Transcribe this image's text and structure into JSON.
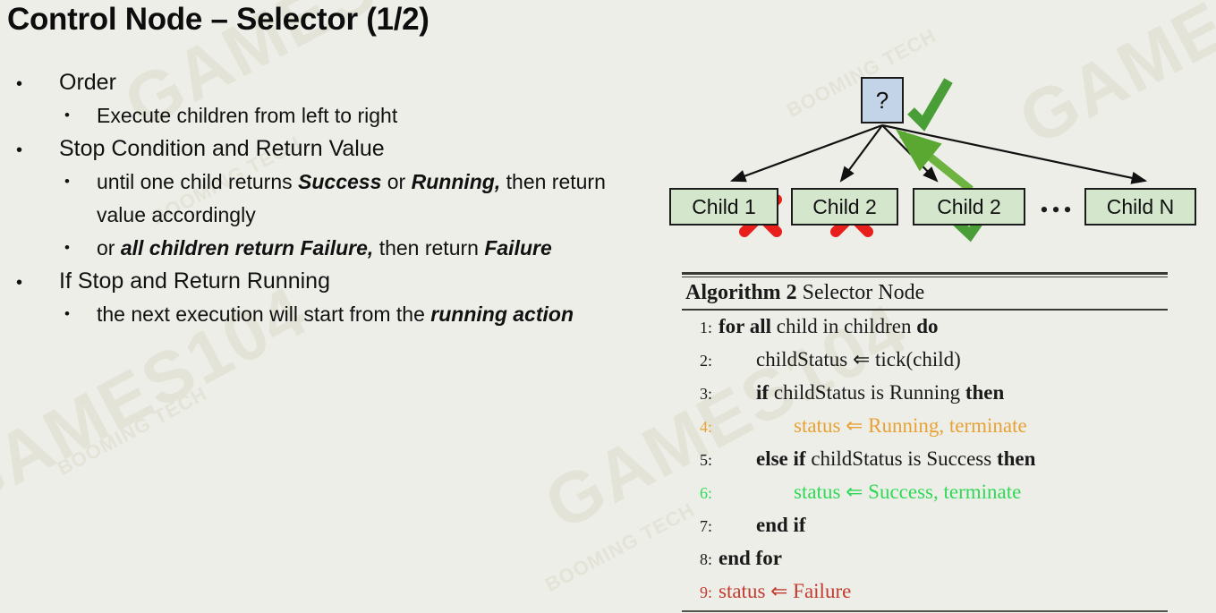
{
  "slide": {
    "title": "Control Node – Selector (1/2)",
    "background_color": "#eeeee9",
    "watermarks": [
      "GAMES104",
      "BOOMING TECH"
    ]
  },
  "bullets": [
    {
      "level": 1,
      "marker": "•",
      "text": "Order"
    },
    {
      "level": 2,
      "marker": "•",
      "text": "Execute children from left to right"
    },
    {
      "level": 1,
      "marker": "•",
      "text": "Stop Condition and Return Value"
    },
    {
      "level": 2,
      "marker": "•",
      "segments": [
        {
          "text": "until one child returns ",
          "style": "normal"
        },
        {
          "text": "Success",
          "style": "bold-italic"
        },
        {
          "text": " or ",
          "style": "normal"
        },
        {
          "text": "Running,",
          "style": "bold-italic"
        },
        {
          "text": " then return value accordingly",
          "style": "normal"
        }
      ]
    },
    {
      "level": 2,
      "marker": "•",
      "segments": [
        {
          "text": "or ",
          "style": "normal"
        },
        {
          "text": "all children return Failure,",
          "style": "bold-italic"
        },
        {
          "text": "  then return ",
          "style": "normal"
        },
        {
          "text": "Failure",
          "style": "bold-italic"
        }
      ]
    },
    {
      "level": 1,
      "marker": "•",
      "text": "If Stop and Return Running"
    },
    {
      "level": 2,
      "marker": "•",
      "segments": [
        {
          "text": "the next execution will start from the ",
          "style": "normal"
        },
        {
          "text": "running action",
          "style": "bold-italic"
        }
      ]
    }
  ],
  "tree": {
    "root": {
      "label": "?",
      "fill": "#c3d3e8",
      "border": "#1b1b1b",
      "status_mark": "check"
    },
    "children": [
      {
        "label": "Child 1",
        "fill": "#d4e7cd",
        "status_mark": "cross"
      },
      {
        "label": "Child 2",
        "fill": "#d4e7cd",
        "status_mark": "cross"
      },
      {
        "label": "Child 2",
        "fill": "#d4e7cd",
        "status_mark": "check"
      },
      {
        "label": "Child N",
        "fill": "#d4e7cd",
        "status_mark": "none"
      }
    ],
    "ellipsis": "•••",
    "edge_color": "#111111",
    "return_arrow_color": "#5aa832",
    "cross_color": "#e8201c",
    "check_color": "#4a9e38"
  },
  "algorithm": {
    "number_label": "Algorithm 2",
    "name": "Selector Node",
    "colors": {
      "default": "#1a1a1a",
      "running": "#e8a233",
      "success": "#2fd957",
      "failure": "#c23b2e"
    },
    "lines": [
      {
        "num": "1:",
        "indent": 0,
        "color": "default",
        "parts": [
          {
            "t": "for all",
            "b": true
          },
          {
            "t": " child in children ",
            "b": false
          },
          {
            "t": "do",
            "b": true
          }
        ]
      },
      {
        "num": "2:",
        "indent": 1,
        "color": "default",
        "parts": [
          {
            "t": "childStatus ⇐ tick(child)",
            "b": false
          }
        ]
      },
      {
        "num": "3:",
        "indent": 1,
        "color": "default",
        "parts": [
          {
            "t": "if",
            "b": true
          },
          {
            "t": " childStatus is Running ",
            "b": false
          },
          {
            "t": "then",
            "b": true
          }
        ]
      },
      {
        "num": "4:",
        "indent": 2,
        "color": "running",
        "parts": [
          {
            "t": "status ⇐ Running, terminate",
            "b": false
          }
        ]
      },
      {
        "num": "5:",
        "indent": 1,
        "color": "default",
        "parts": [
          {
            "t": "else if",
            "b": true
          },
          {
            "t": " childStatus is Success ",
            "b": false
          },
          {
            "t": "then",
            "b": true
          }
        ]
      },
      {
        "num": "6:",
        "indent": 2,
        "color": "success",
        "parts": [
          {
            "t": "status ⇐ Success, terminate",
            "b": false
          }
        ]
      },
      {
        "num": "7:",
        "indent": 1,
        "color": "default",
        "parts": [
          {
            "t": "end if",
            "b": true
          }
        ]
      },
      {
        "num": "8:",
        "indent": 0,
        "color": "default",
        "parts": [
          {
            "t": "end for",
            "b": true
          }
        ]
      },
      {
        "num": "9:",
        "indent": 0,
        "color": "failure",
        "parts": [
          {
            "t": "status ⇐ Failure",
            "b": false
          }
        ]
      }
    ]
  }
}
